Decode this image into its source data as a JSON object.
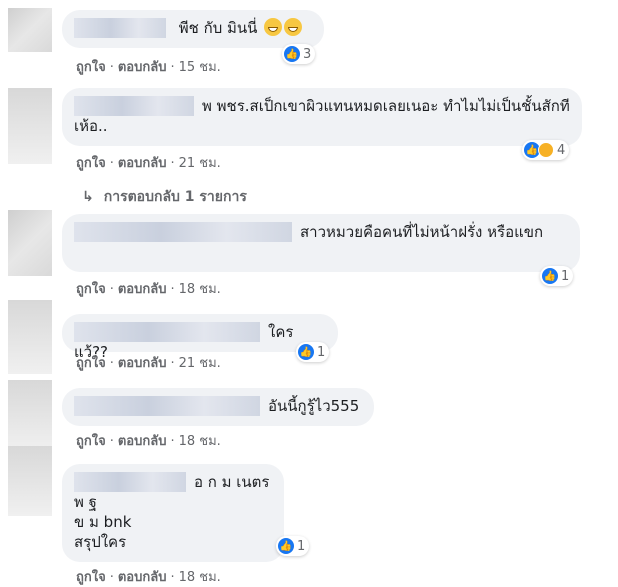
{
  "actions": {
    "like": "ถูกใจ",
    "reply": "ตอบกลับ",
    "dot": "·"
  },
  "view_replies": "การตอบกลับ 1 รายการ",
  "comments": [
    {
      "text": "พีช กับ มินนี่",
      "reactions": "3",
      "time": "15 ชม."
    },
    {
      "text": "พ พชร.สเป็กเขาผิวแทนหมดเลยเนอะ ทำไมไม่เป็นชั้นสักที เห้อ..",
      "reactions": "4",
      "time": "21 ชม."
    },
    {
      "text": "สาวหมวยคือคนที่ไม่หน้าฝรั่ง หรือแขก",
      "reactions": "1",
      "time": "18 ชม."
    },
    {
      "text": "ใครแว้??",
      "reactions": "1",
      "time": "21 ชม."
    },
    {
      "text": "อันนี้กูรู้ไว555",
      "reactions": "",
      "time": "18 ชม."
    },
    {
      "text": "อ ก ม เนตร",
      "line2": "พ ฐ",
      "line3": "ข ม bnk",
      "line4": "สรุปใคร",
      "reactions": "1",
      "time": "18 ชม."
    }
  ],
  "icons": {
    "like": "thumbs-up-icon",
    "haha": "haha-reaction-icon",
    "reply_arrow": "reply-arrow-icon"
  }
}
